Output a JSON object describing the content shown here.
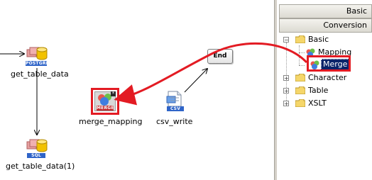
{
  "canvas": {
    "nodes": {
      "get_table_data": {
        "label": "get_table_data",
        "badge": "POSTGRE"
      },
      "get_table_data_1": {
        "label": "get_table_data(1)",
        "badge": "SQL"
      },
      "merge_mapping": {
        "label": "merge_mapping",
        "badge": "MERGE"
      },
      "csv_write": {
        "label": "csv_write",
        "badge": "CSV"
      },
      "end": {
        "label": "End"
      }
    }
  },
  "panel": {
    "tabs": [
      "Basic",
      "Conversion"
    ],
    "tree": {
      "basic": {
        "label": "Basic",
        "children": [
          "Mapping",
          "Merge"
        ]
      },
      "character": "Character",
      "table": "Table",
      "xslt": "XSLT"
    }
  },
  "colors": {
    "highlight": "#e31b23",
    "selection": "#0a246a",
    "db_yellow": "#f2c200",
    "badge_blue": "#2f64c8"
  }
}
